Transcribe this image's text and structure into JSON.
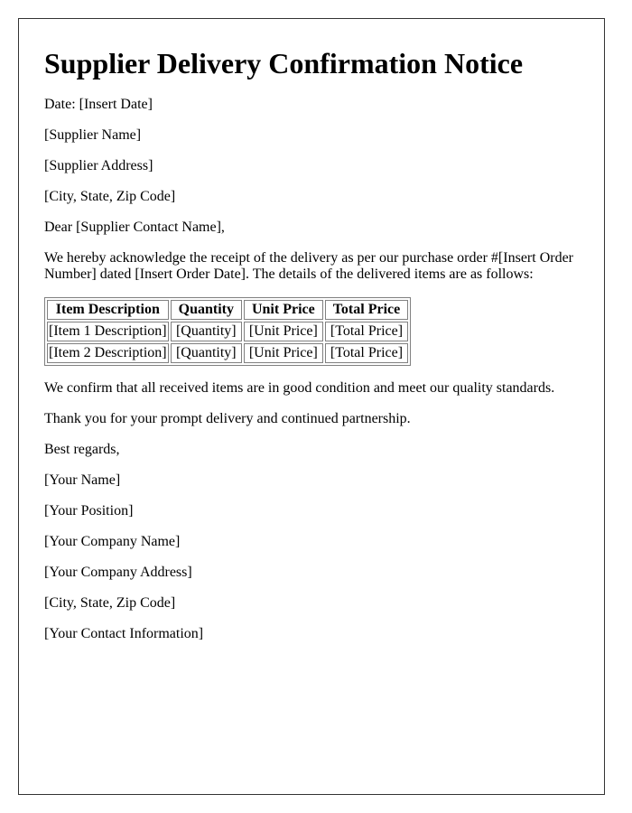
{
  "title": "Supplier Delivery Confirmation Notice",
  "date_line": "Date: [Insert Date]",
  "recipient": {
    "name": "[Supplier Name]",
    "address": "[Supplier Address]",
    "city_state_zip": "[City, State, Zip Code]"
  },
  "salutation": "Dear [Supplier Contact Name],",
  "intro": "We hereby acknowledge the receipt of the delivery as per our purchase order #[Insert Order Number] dated [Insert Order Date]. The details of the delivered items are as follows:",
  "table": {
    "headers": [
      "Item Description",
      "Quantity",
      "Unit Price",
      "Total Price"
    ],
    "rows": [
      [
        "[Item 1 Description]",
        "[Quantity]",
        "[Unit Price]",
        "[Total Price]"
      ],
      [
        "[Item 2 Description]",
        "[Quantity]",
        "[Unit Price]",
        "[Total Price]"
      ]
    ]
  },
  "confirmation": "We confirm that all received items are in good condition and meet our quality standards.",
  "thanks": "Thank you for your prompt delivery and continued partnership.",
  "closing": "Best regards,",
  "sender": {
    "name": "[Your Name]",
    "position": "[Your Position]",
    "company": "[Your Company Name]",
    "address": "[Your Company Address]",
    "city_state_zip": "[City, State, Zip Code]",
    "contact": "[Your Contact Information]"
  }
}
